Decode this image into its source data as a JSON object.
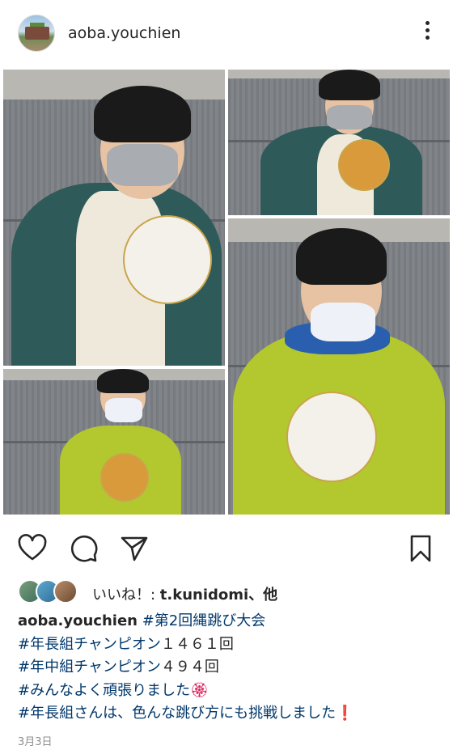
{
  "post": {
    "username": "aoba.youchien",
    "avatar_icon": "avatar-school-building",
    "more_icon": "more-options-icon"
  },
  "actions": {
    "like_icon": "heart-icon",
    "comment_icon": "comment-icon",
    "share_icon": "send-icon",
    "save_icon": "bookmark-icon"
  },
  "likes": {
    "prefix": "いいね！: ",
    "user": "t.kunidomi",
    "suffix": "、他"
  },
  "caption": {
    "username": "aoba.youchien",
    "line1_tag": "#第2回縄跳び大会",
    "line2_tag": "#年長組チャンピオン",
    "line2_text": "１４６１回",
    "line3_tag": "#年中組チャンピオン",
    "line3_text": "４９４回",
    "line4_tag": "#みんなよく頑張りました",
    "line4_emoji": "🏵",
    "line5_tag": "#年長組さんは、色んな跳び方にも挑戦しました",
    "line5_emoji": "❗"
  },
  "date": "3月3日",
  "colors": {
    "text": "#262626",
    "hashtag": "#00376b",
    "muted": "#8e8e8e"
  }
}
